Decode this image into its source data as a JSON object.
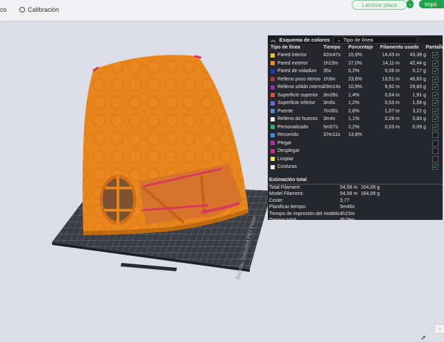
{
  "toolbar": {
    "left_fragment": "co",
    "calibration_label": "Calibración",
    "slice_label": "Laminar placa",
    "print_label": "Impri",
    "dropdown_glyph": "⌄"
  },
  "plate": {
    "label": "Bambu Textured PEI Plate"
  },
  "legend": {
    "collapse_glyph": "︽",
    "scheme_label": "Esquema de colores",
    "selected_scheme": "Tipo de línea",
    "headers": {
      "type": "Tipo de línea",
      "time": "Tiempo",
      "percent": "Porcentaje",
      "filament": "Filamento usado",
      "show": "Pantalla"
    },
    "rows": [
      {
        "name": "Pared interior",
        "color": "#f5c032",
        "time": "42m47s",
        "percent": "15,9%",
        "length": "14,43 m",
        "weight": "43,38 g",
        "shown": true
      },
      {
        "name": "Pared exterior",
        "color": "#f08a2a",
        "time": "1h13m",
        "percent": "27,0%",
        "length": "14,11 m",
        "weight": "42,44 g",
        "shown": true
      },
      {
        "name": "Pared de voladizo",
        "color": "#2233cc",
        "time": "35s",
        "percent": "0,2%",
        "length": "0,06 m",
        "weight": "0,17 g",
        "shown": true
      },
      {
        "name": "Relleno poco denso",
        "color": "#a83a3a",
        "time": "1h3m",
        "percent": "23,6%",
        "length": "13,51 m",
        "weight": "40,63 g",
        "shown": true
      },
      {
        "name": "Relleno sólido interno",
        "color": "#9a2fb0",
        "time": "29m14s",
        "percent": "10,9%",
        "length": "9,92 m",
        "weight": "29,83 g",
        "shown": true
      },
      {
        "name": "Superficie superior",
        "color": "#e04848",
        "time": "3m39s",
        "percent": "1,4%",
        "length": "0,64 m",
        "weight": "1,91 g",
        "shown": true
      },
      {
        "name": "Superficie inferior",
        "color": "#6a6af0",
        "time": "3m6s",
        "percent": "1,2%",
        "length": "0,53 m",
        "weight": "1,58 g",
        "shown": true
      },
      {
        "name": "Puente",
        "color": "#5a8ad6",
        "time": "7m30s",
        "percent": "2,8%",
        "length": "1,07 m",
        "weight": "3,22 g",
        "shown": true
      },
      {
        "name": "Relleno de huecos",
        "color": "#f0f0f0",
        "time": "3m4s",
        "percent": "1,1%",
        "length": "0,28 m",
        "weight": "0,83 g",
        "shown": true
      },
      {
        "name": "Personalizado",
        "color": "#2fb06a",
        "time": "5m57s",
        "percent": "2,2%",
        "length": "0,03 m",
        "weight": "0,09 g",
        "shown": true
      },
      {
        "name": "Recorrido",
        "color": "#3a8fe0",
        "time": "37m11s",
        "percent": "13,8%",
        "length": "",
        "weight": "",
        "shown": false
      },
      {
        "name": "Plegar",
        "color": "#b030b0",
        "time": "",
        "percent": "",
        "length": "",
        "weight": "",
        "shown": false
      },
      {
        "name": "Desplegar",
        "color": "#d22a8a",
        "time": "",
        "percent": "",
        "length": "",
        "weight": "",
        "shown": false
      },
      {
        "name": "Limpiar",
        "color": "#f0ec3a",
        "time": "",
        "percent": "",
        "length": "",
        "weight": "",
        "shown": false
      },
      {
        "name": "Costuras",
        "color": "#e8e8e8",
        "time": "",
        "percent": "",
        "length": "",
        "weight": "",
        "shown": true
      }
    ],
    "estimate": {
      "title": "Estimación total",
      "rows": [
        {
          "label": "Total Filament:",
          "v1": "54,58 m",
          "v2": "164,09 g"
        },
        {
          "label": "Model Filament:",
          "v1": "54,58 m",
          "v2": "164,09 g"
        },
        {
          "label": "Coste:",
          "v1": "3,77",
          "v2": ""
        },
        {
          "label": "Planificar tiempo:",
          "v1": "5m46s",
          "v2": ""
        },
        {
          "label": "Tiempo de impresión del modelo:",
          "v1": "4h23m",
          "v2": ""
        },
        {
          "label": "Tiempo total:",
          "v1": "4h29m",
          "v2": ""
        }
      ]
    }
  },
  "colors": {
    "model_orange": "#e8861c",
    "plate_dark": "#3a3c44",
    "accent_green": "#1fa24a"
  }
}
